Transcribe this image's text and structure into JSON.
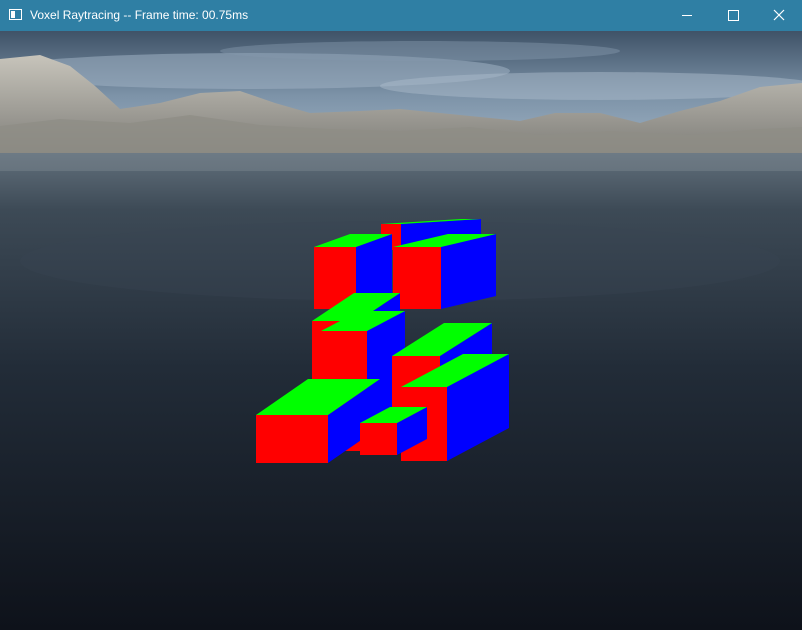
{
  "window": {
    "title": "Voxel Raytracing -- Frame time: 00.75ms",
    "titlebar_color": "#2f7fa4",
    "icon": "app-window-icon",
    "controls": [
      "minimize-icon",
      "maximize-icon",
      "close-icon"
    ]
  },
  "scene": {
    "voxel_face_colors": {
      "top": "#00ff00",
      "front": "#ff0000",
      "side": "#0000ff"
    },
    "sky_color": "#8aa3b8",
    "water_color": "#1a2330"
  }
}
